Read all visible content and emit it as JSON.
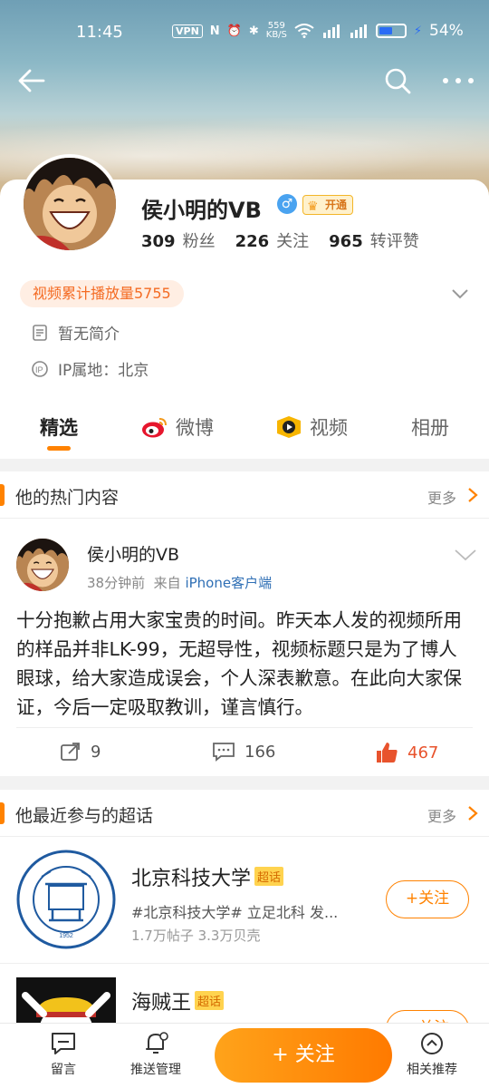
{
  "status_bar": {
    "time": "11:45",
    "vpn": "VPN",
    "net_speed_value": "559",
    "net_speed_unit": "KB/S",
    "battery_percent": "54%",
    "battery_level": 0.54
  },
  "profile": {
    "username": "侯小明的VB",
    "vip_label": "开通",
    "stats": [
      {
        "value": "309",
        "label": "粉丝"
      },
      {
        "value": "226",
        "label": "关注"
      },
      {
        "value": "965",
        "label": "转评赞"
      }
    ],
    "play_count": "视频累计播放量5755",
    "bio": "暂无简介",
    "ip": "IP属地：北京"
  },
  "tabs": [
    {
      "label": "精选",
      "active": true
    },
    {
      "label": "微博"
    },
    {
      "label": "视频"
    },
    {
      "label": "相册"
    }
  ],
  "hot_section": {
    "title": "他的热门内容",
    "more": "更多"
  },
  "post": {
    "author": "侯小明的VB",
    "time": "38分钟前",
    "from_label": "来自",
    "source": "iPhone客户端",
    "text": "十分抱歉占用大家宝贵的时间。昨天本人发的视频所用的样品并非LK-99，无超导性，视频标题只是为了博人眼球，给大家造成误会，个人深表歉意。在此向大家保证，今后一定吸取教训，谨言慎行。",
    "reposts": "9",
    "comments": "166",
    "likes": "467"
  },
  "topics_section": {
    "title": "他最近参与的超话",
    "more": "更多",
    "tag": "超话",
    "items": [
      {
        "name": "北京科技大学",
        "desc": "#北京科技大学#  立足北科  发...",
        "stats": "1.7万帖子 3.3万贝壳",
        "follow": "+关注",
        "logo_text": "UNIVERSITY OF SCIENCE AND TECHNOLOGY · 1952 ·",
        "logo_year": "1952"
      },
      {
        "name": "海贼王",
        "follow": "+关注"
      }
    ]
  },
  "bottom_bar": {
    "message": "留言",
    "push": "推送管理",
    "follow": "+ 关注",
    "related": "相关推荐"
  },
  "colors": {
    "accent": "#ff8200",
    "like": "#e8532d",
    "link": "#2f6fb5"
  }
}
